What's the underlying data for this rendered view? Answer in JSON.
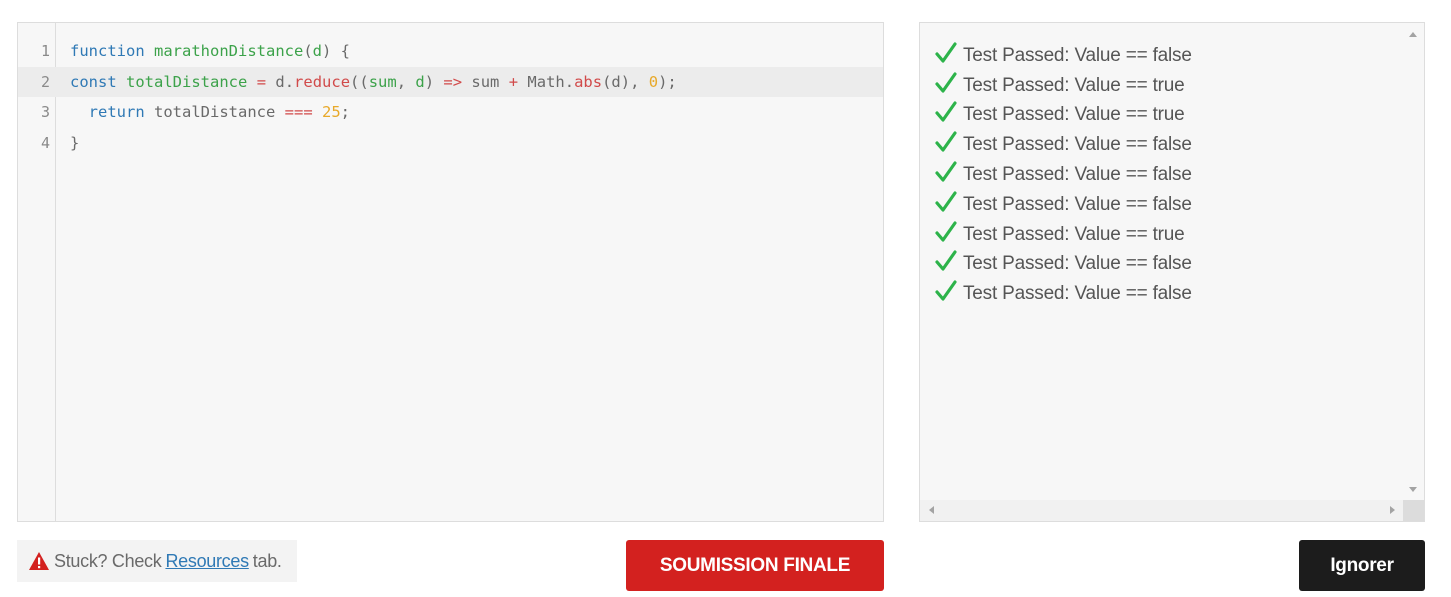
{
  "editor": {
    "lines": [
      {
        "number": "1",
        "tokens": [
          {
            "t": "function",
            "c": "kw"
          },
          {
            "t": " ",
            "c": "txt"
          },
          {
            "t": "marathonDistance",
            "c": "fn"
          },
          {
            "t": "(",
            "c": "txt"
          },
          {
            "t": "d",
            "c": "fn"
          },
          {
            "t": ") {",
            "c": "txt"
          }
        ]
      },
      {
        "number": "2",
        "tokens": [
          {
            "t": "const",
            "c": "kw"
          },
          {
            "t": " ",
            "c": "txt"
          },
          {
            "t": "totalDistance",
            "c": "fn"
          },
          {
            "t": " ",
            "c": "txt"
          },
          {
            "t": "=",
            "c": "op"
          },
          {
            "t": " d.",
            "c": "txt"
          },
          {
            "t": "reduce",
            "c": "op"
          },
          {
            "t": "((",
            "c": "txt"
          },
          {
            "t": "sum",
            "c": "fn"
          },
          {
            "t": ", ",
            "c": "txt"
          },
          {
            "t": "d",
            "c": "fn"
          },
          {
            "t": ") ",
            "c": "txt"
          },
          {
            "t": "=>",
            "c": "op"
          },
          {
            "t": " sum ",
            "c": "txt"
          },
          {
            "t": "+",
            "c": "op"
          },
          {
            "t": " Math.",
            "c": "txt"
          },
          {
            "t": "abs",
            "c": "op"
          },
          {
            "t": "(d), ",
            "c": "txt"
          },
          {
            "t": "0",
            "c": "num"
          },
          {
            "t": ");",
            "c": "txt"
          }
        ]
      },
      {
        "number": "3",
        "tokens": [
          {
            "t": "  ",
            "c": "txt"
          },
          {
            "t": "return",
            "c": "kw"
          },
          {
            "t": " totalDistance ",
            "c": "txt"
          },
          {
            "t": "===",
            "c": "op"
          },
          {
            "t": " ",
            "c": "txt"
          },
          {
            "t": "25",
            "c": "num"
          },
          {
            "t": ";",
            "c": "txt"
          }
        ]
      },
      {
        "number": "4",
        "tokens": [
          {
            "t": "}",
            "c": "txt"
          }
        ]
      }
    ],
    "active_line": 1
  },
  "results": {
    "items": [
      "Test Passed: Value == false",
      "Test Passed: Value == true",
      "Test Passed: Value == true",
      "Test Passed: Value == false",
      "Test Passed: Value == false",
      "Test Passed: Value == false",
      "Test Passed: Value == true",
      "Test Passed: Value == false",
      "Test Passed: Value == false"
    ],
    "icon": "check-icon",
    "pass_color": "#2db34a"
  },
  "hint": {
    "prefix": "Stuck? Check",
    "link": "Resources",
    "suffix": "tab.",
    "icon": "warning-icon",
    "icon_color": "#d3211f"
  },
  "actions": {
    "submit_label": "SOUMISSION FINALE",
    "ignore_label": "Ignorer",
    "submit_color": "#d3211f",
    "ignore_color": "#1c1c1c"
  }
}
